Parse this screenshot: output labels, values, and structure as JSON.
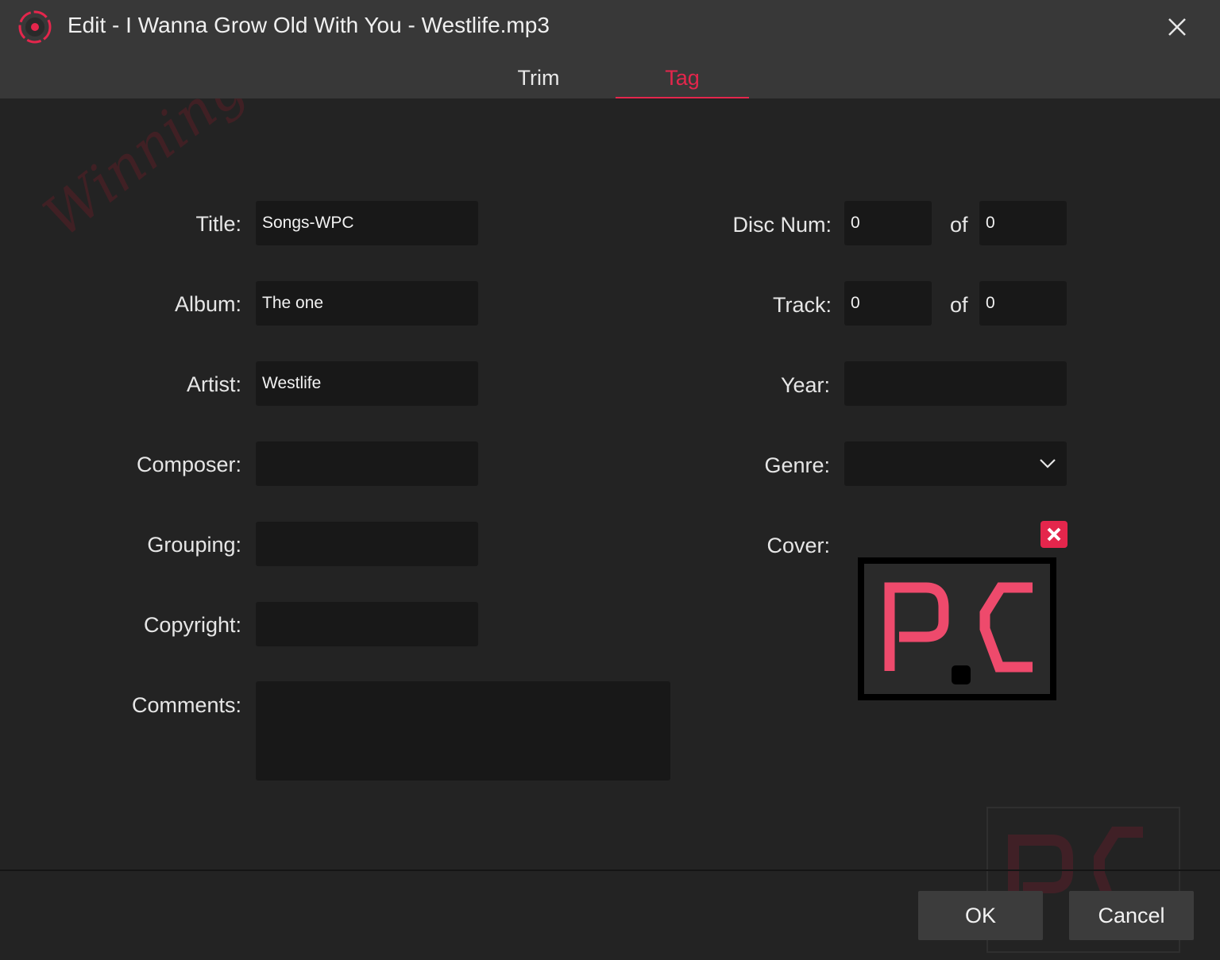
{
  "window": {
    "title": "Edit - I Wanna Grow Old With You - Westlife.mp3"
  },
  "tabs": [
    {
      "label": "Trim",
      "active": false
    },
    {
      "label": "Tag",
      "active": true
    }
  ],
  "left_fields": {
    "title": {
      "label": "Title:",
      "value": "Songs-WPC"
    },
    "album": {
      "label": "Album:",
      "value": "The one"
    },
    "artist": {
      "label": "Artist:",
      "value": "Westlife"
    },
    "composer": {
      "label": "Composer:",
      "value": ""
    },
    "grouping": {
      "label": "Grouping:",
      "value": ""
    },
    "copyright": {
      "label": "Copyright:",
      "value": ""
    },
    "comments": {
      "label": "Comments:",
      "value": ""
    }
  },
  "right_fields": {
    "disc": {
      "label": "Disc Num:",
      "value": "0",
      "of_label": "of",
      "of_value": "0"
    },
    "track": {
      "label": "Track:",
      "value": "0",
      "of_label": "of",
      "of_value": "0"
    },
    "year": {
      "label": "Year:",
      "value": ""
    },
    "genre": {
      "label": "Genre:",
      "value": ""
    },
    "cover": {
      "label": "Cover:"
    }
  },
  "footer": {
    "ok_label": "OK",
    "cancel_label": "Cancel"
  },
  "watermark": {
    "text": "Winning PC",
    "logo_text": "PC"
  },
  "colors": {
    "accent": "#e4264c",
    "background": "#232323",
    "titlebar": "#383838",
    "field": "#181818",
    "logo_pink": "#ee4a6c"
  }
}
